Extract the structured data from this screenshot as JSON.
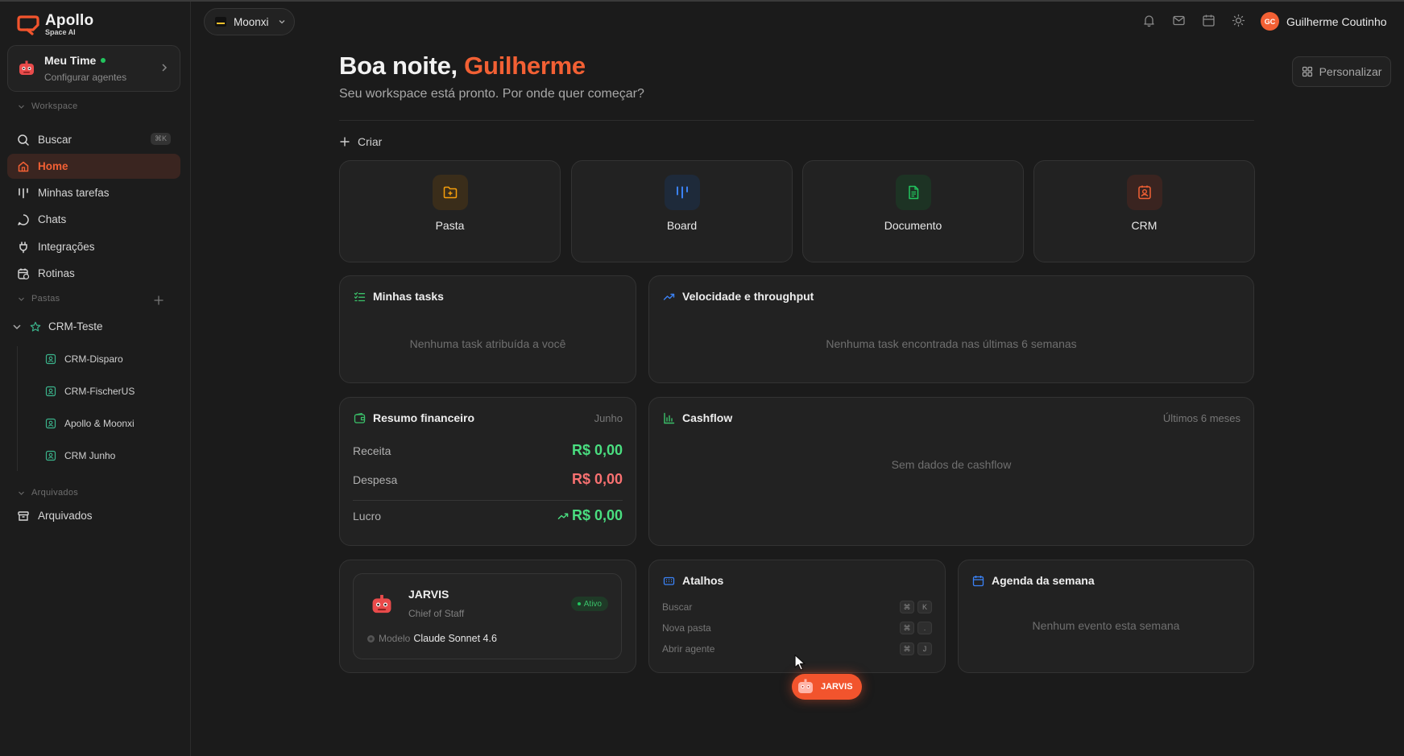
{
  "app": {
    "brand": "Apollo",
    "brand_sub": "Space AI",
    "accent_color": "#f26034"
  },
  "sidebar": {
    "team": {
      "name": "Meu Time",
      "sub": "Configurar agentes",
      "status_color": "#22c55e"
    },
    "workspace_label": "Workspace",
    "items": [
      {
        "label": "Buscar",
        "icon": "search-icon",
        "shortcut": "⌘K"
      },
      {
        "label": "Home",
        "icon": "home-icon",
        "active": true
      },
      {
        "label": "Minhas tarefas",
        "icon": "tasks-icon"
      },
      {
        "label": "Chats",
        "icon": "chat-icon"
      },
      {
        "label": "Integrações",
        "icon": "plug-icon"
      },
      {
        "label": "Rotinas",
        "icon": "calendar-clock-icon"
      }
    ],
    "pastas_label": "Pastas",
    "folder": {
      "label": "CRM-Teste",
      "icon": "star-icon"
    },
    "sub_items": [
      {
        "label": "CRM-Disparo"
      },
      {
        "label": "CRM-FischerUS"
      },
      {
        "label": "Apollo & Moonxi"
      },
      {
        "label": "CRM Junho"
      }
    ],
    "arquivados_label": "Arquivados",
    "arquivados_item": "Arquivados"
  },
  "topbar": {
    "workspace": "Moonxi",
    "icons": [
      "bell-icon",
      "mail-icon",
      "calendar-icon",
      "sun-icon"
    ],
    "user_initials": "GC",
    "user_name": "Guilherme Coutinho"
  },
  "main": {
    "greeting": "Boa noite,",
    "greeting_name": "Guilherme",
    "subtitle": "Seu workspace está pronto. Por onde quer começar?",
    "personalize": "Personalizar",
    "create_label": "Criar",
    "create_cards": [
      {
        "label": "Pasta",
        "icon": "folder-plus-icon",
        "color": "#f59e0b",
        "bg": "#3a2d1a"
      },
      {
        "label": "Board",
        "icon": "board-icon",
        "color": "#3b82f6",
        "bg": "#1e2a3a"
      },
      {
        "label": "Documento",
        "icon": "document-icon",
        "color": "#22c55e",
        "bg": "#1d3324"
      },
      {
        "label": "CRM",
        "icon": "contact-icon",
        "color": "#f26034",
        "bg": "#3a2420"
      }
    ],
    "tasks": {
      "title": "Minhas tasks",
      "empty": "Nenhuma task atribuída a você"
    },
    "velocity": {
      "title": "Velocidade e throughput",
      "empty": "Nenhuma task encontrada nas últimas 6 semanas"
    },
    "finance": {
      "title": "Resumo financeiro",
      "period": "Junho",
      "receita_label": "Receita",
      "receita_value": "R$ 0,00",
      "despesa_label": "Despesa",
      "despesa_value": "R$ 0,00",
      "lucro_label": "Lucro",
      "lucro_value": "R$ 0,00"
    },
    "cashflow": {
      "title": "Cashflow",
      "period": "Últimos 6 meses",
      "empty": "Sem dados de cashflow"
    },
    "agent": {
      "name": "JARVIS",
      "role": "Chief of Staff",
      "status": "Ativo",
      "model_label": "Modelo",
      "model_value": "Claude Sonnet 4.6"
    },
    "shortcuts": {
      "title": "Atalhos",
      "items": [
        {
          "label": "Buscar",
          "keys": [
            "⌘",
            "K"
          ]
        },
        {
          "label": "Nova pasta",
          "keys": [
            "⌘",
            "."
          ]
        },
        {
          "label": "Abrir agente",
          "keys": [
            "⌘",
            "J"
          ]
        }
      ]
    },
    "agenda": {
      "title": "Agenda da semana",
      "empty": "Nenhum evento esta semana"
    }
  },
  "fab": {
    "label": "JARVIS"
  }
}
